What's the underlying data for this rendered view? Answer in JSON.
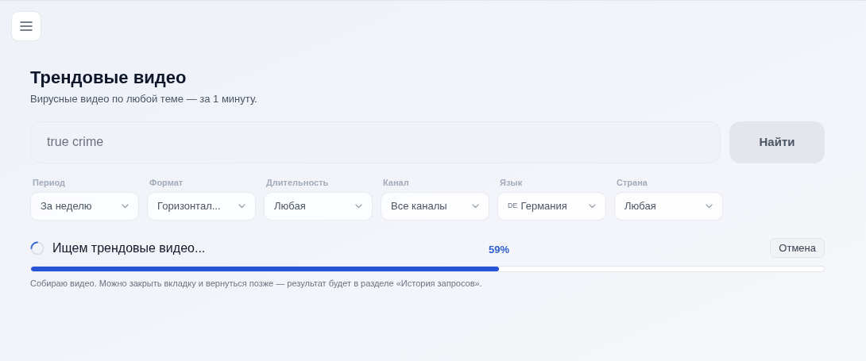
{
  "header": {
    "title": "Трендовые видео",
    "subtitle": "Вирусные видео по любой теме — за 1 минуту."
  },
  "search": {
    "value": "true crime",
    "button": "Найти"
  },
  "filters": [
    {
      "label": "Период",
      "value": "За неделю"
    },
    {
      "label": "Формат",
      "value": "Горизонтал..."
    },
    {
      "label": "Длительность",
      "value": "Любая"
    },
    {
      "label": "Канал",
      "value": "Все каналы"
    },
    {
      "label": "Язык",
      "prefix": "DE",
      "value": "Германия"
    },
    {
      "label": "Страна",
      "value": "Любая"
    }
  ],
  "progress": {
    "status": "Ищем трендовые видео...",
    "percent": "59%",
    "level": 0.59,
    "cancel": "Отмена",
    "note": "Собираю видео. Можно закрыть вкладку и вернуться позже — результат будет в разделе «История запросов»."
  }
}
